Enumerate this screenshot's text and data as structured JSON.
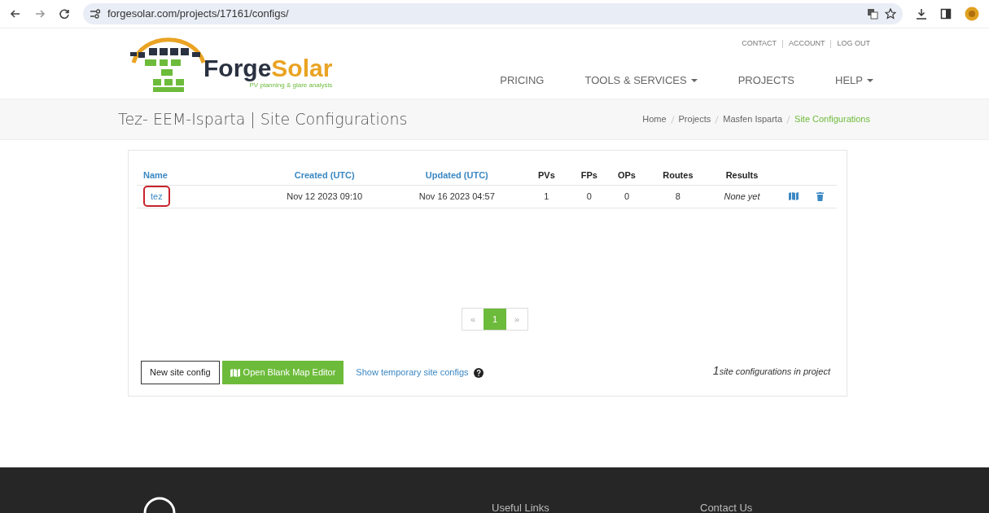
{
  "browser": {
    "url": "forgesolar.com/projects/17161/configs/"
  },
  "header": {
    "logo": {
      "word_1": "Forge",
      "word_2": "Solar",
      "tagline": "PV planning & glare analysis"
    },
    "top_links": [
      "CONTACT",
      "ACCOUNT",
      "LOG OUT"
    ],
    "nav": [
      {
        "label": "PRICING",
        "dropdown": false
      },
      {
        "label": "TOOLS & SERVICES",
        "dropdown": true
      },
      {
        "label": "PROJECTS",
        "dropdown": false
      },
      {
        "label": "HELP",
        "dropdown": true
      }
    ]
  },
  "page_title": "Tez- EEM-Isparta | Site Configurations",
  "breadcrumb": [
    {
      "label": "Home",
      "current": false
    },
    {
      "label": "Projects",
      "current": false
    },
    {
      "label": "Masfen Isparta",
      "current": false
    },
    {
      "label": "Site Configurations",
      "current": true
    }
  ],
  "table": {
    "columns": [
      {
        "label": "Name",
        "sortable": true
      },
      {
        "label": "Created (UTC)",
        "sortable": true
      },
      {
        "label": "Updated (UTC)",
        "sortable": true
      },
      {
        "label": "PVs",
        "sortable": false
      },
      {
        "label": "FPs",
        "sortable": false
      },
      {
        "label": "OPs",
        "sortable": false
      },
      {
        "label": "Routes",
        "sortable": false
      },
      {
        "label": "Results",
        "sortable": false
      }
    ],
    "rows": [
      {
        "name": "tez",
        "circled": true,
        "created": "Nov 12 2023 09:10",
        "updated": "Nov 16 2023 04:57",
        "pvs": "1",
        "fps": "0",
        "ops": "0",
        "routes": "8",
        "results": "None yet"
      }
    ]
  },
  "pagination": {
    "prev": "«",
    "next": "»",
    "pages": [
      {
        "label": "1",
        "selected": true
      }
    ]
  },
  "actions": {
    "new_button": "New site config",
    "map_button": "Open Blank Map Editor",
    "temp_link": "Show temporary site configs",
    "count": "1",
    "count_text": "site configurations in project"
  },
  "footer": {
    "headings": [
      "Useful Links",
      "Contact Us"
    ]
  }
}
